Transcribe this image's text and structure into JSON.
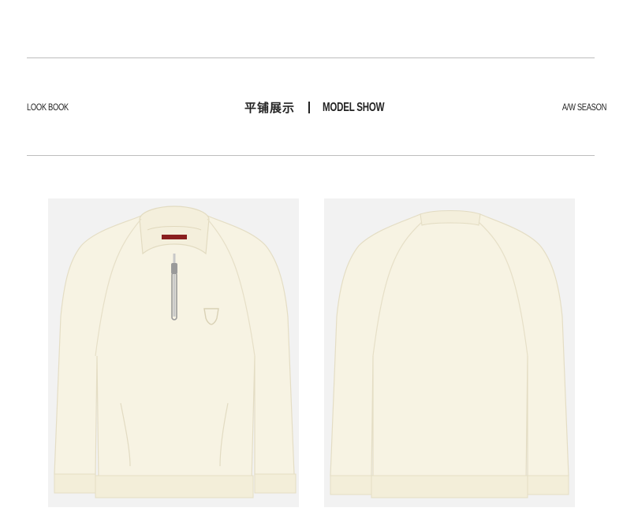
{
  "header": {
    "left_label": "LOOK BOOK",
    "title_cn": "平铺展示",
    "title_en": "MODEL SHOW",
    "right_label": "A/W SEASON"
  },
  "colors": {
    "garment": "#f7f3e3",
    "garment_shade": "#e9e3cd",
    "photo_bg": "#f2f2f2",
    "rule": "#bdbdbd",
    "label_tag": "#8a1f1f"
  },
  "images": [
    {
      "name": "front-view",
      "depicts": "cream half-zip fleece sweatshirt front"
    },
    {
      "name": "back-view",
      "depicts": "cream half-zip fleece sweatshirt back"
    }
  ]
}
